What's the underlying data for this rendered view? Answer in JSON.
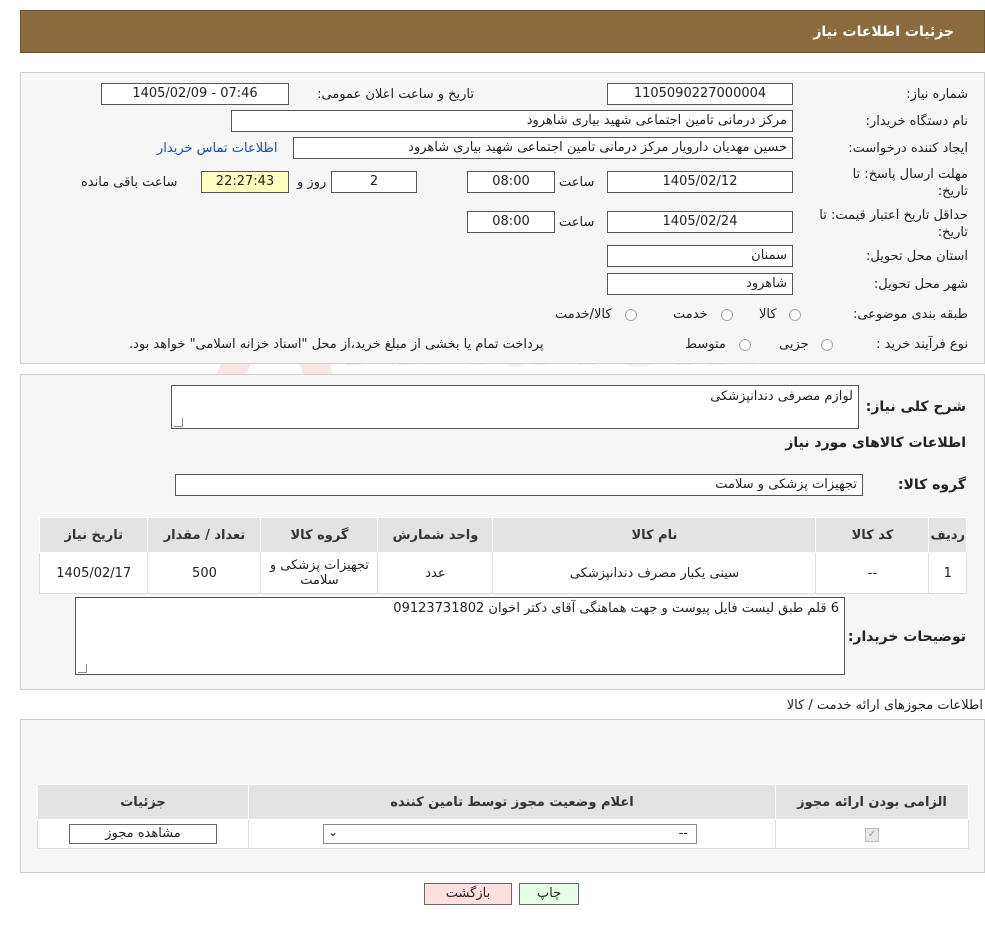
{
  "header": {
    "title": "جزئیات اطلاعات نیاز"
  },
  "form": {
    "need_number_label": "شماره نیاز:",
    "need_number": "1105090227000004",
    "announce_label": "تاریخ و ساعت اعلان عمومی:",
    "announce_value": "1405/02/09 - 07:46",
    "buyer_org_label": "نام دستگاه خریدار:",
    "buyer_org": "مرکز درمانی تامین اجتماعی شهید بیاری شاهرود",
    "creator_label": "ایجاد کننده درخواست:",
    "creator": "حسین مهدیان دارویار مرکز درمانی تامین اجتماعی شهید بیاری شاهرود",
    "contact_link": "اطلاعات تماس خریدار",
    "deadline_label": "مهلت ارسال پاسخ: تا تاریخ:",
    "deadline_date": "1405/02/12",
    "time_label": "ساعت",
    "deadline_time": "08:00",
    "days_value": "2",
    "days_label": "روز و",
    "remaining_time": "22:27:43",
    "remaining_label": "ساعت باقی مانده",
    "validity_label": "حداقل تاریخ اعتبار قیمت: تا تاریخ:",
    "validity_date": "1405/02/24",
    "validity_time": "08:00",
    "province_label": "استان محل تحویل:",
    "province": "سمنان",
    "city_label": "شهر محل تحویل:",
    "city": "شاهرود",
    "category_label": "طبقه بندی موضوعی:",
    "category_options": [
      "کالا",
      "خدمت",
      "کالا/خدمت"
    ],
    "process_label": "نوع فرآیند خرید :",
    "process_options": [
      "جزیی",
      "متوسط"
    ],
    "process_note": "پرداخت تمام یا بخشی از مبلغ خرید،از محل \"اسناد خزانه اسلامی\" خواهد بود."
  },
  "goods": {
    "summary_label": "شرح کلی نیاز:",
    "summary": "لوازم مصرفی دندانپزشکی",
    "section_title": "اطلاعات کالاهای مورد نیاز",
    "group_label": "گروه کالا:",
    "group": "تجهیزات پزشکی و سلامت",
    "columns": [
      "ردیف",
      "کد کالا",
      "نام کالا",
      "واحد شمارش",
      "گروه کالا",
      "تعداد / مقدار",
      "تاریخ نیاز"
    ],
    "rows": [
      [
        "1",
        "--",
        "سینی یکبار مصرف دندانپزشکی",
        "عدد",
        "تجهیزات پزشکی و سلامت",
        "500",
        "1405/02/17"
      ]
    ],
    "buyer_notes_label": "توضیحات خریدار:",
    "buyer_notes": "6 قلم طبق لیست فایل پیوست و جهت هماهنگی آقای دکتر اخوان 09123731802"
  },
  "permits": {
    "title": "اطلاعات مجوزهای ارائه خدمت / کالا",
    "columns": [
      "الزامی بودن ارائه مجوز",
      "اعلام وضعیت مجوز توسط تامین کننده",
      "جزئیات"
    ],
    "select_value": "--",
    "view_button": "مشاهده مجوز"
  },
  "actions": {
    "print": "چاپ",
    "back": "بازگشت"
  },
  "watermark": {
    "text": "AriaTender.neT"
  },
  "colors": {
    "header": "#8b6a3e",
    "link": "#1a4fb4",
    "back_button": "#ffe0e0",
    "print_button": "#e6ffe6"
  }
}
